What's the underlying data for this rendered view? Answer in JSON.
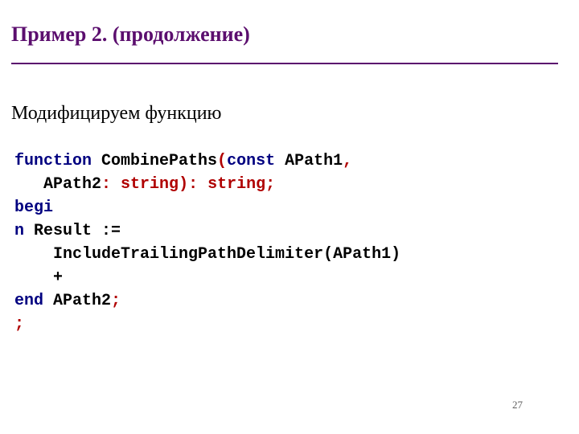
{
  "title": "Пример 2. (продолжение)",
  "subtitle": "Модифицируем функцию",
  "code": {
    "l1": {
      "kw1": "function",
      "name": " CombinePaths",
      "p_open": "(",
      "kw2": "const",
      "p1": " APath1",
      "comma": ","
    },
    "l2": {
      "indent": "   ",
      "p2": "APath2",
      "colon": ": ",
      "t1": "string",
      "paren_close": ")",
      "colon2": ": ",
      "t2": "string",
      "semi": ";"
    },
    "l3": {
      "begi": "begi"
    },
    "l4": {
      "n": "n",
      "body": " Result :="
    },
    "l5": {
      "indent": "    ",
      "call": "IncludeTrailingPathDelimiter(APath1)"
    },
    "l6": {
      "indent": "    ",
      "plus": "+"
    },
    "l7": {
      "end": "end",
      "sp": " ",
      "ap2": "APath2",
      "semi": ";"
    },
    "l8": {
      "semi": ";"
    }
  },
  "page_number": "27"
}
